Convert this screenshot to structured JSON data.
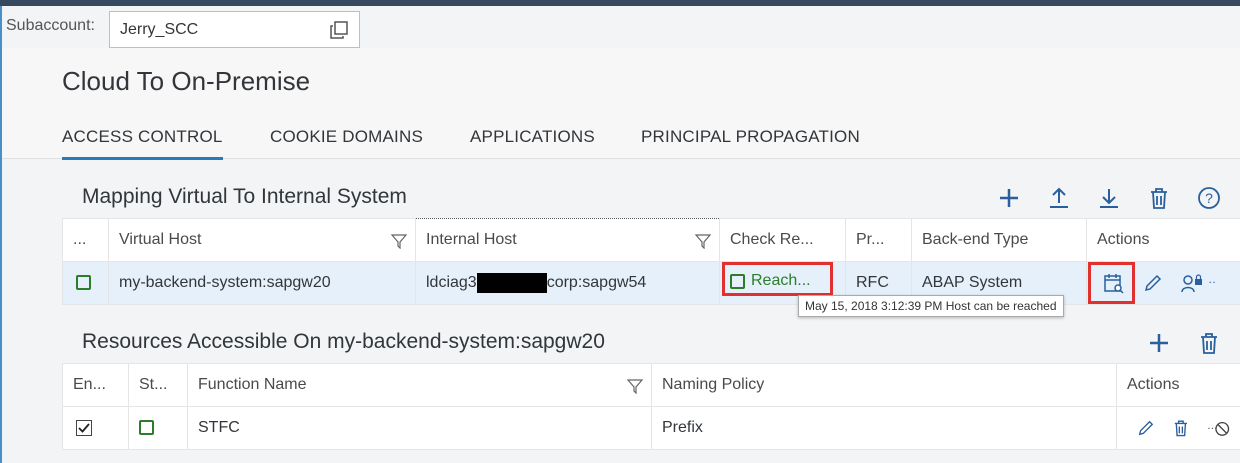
{
  "subaccount": {
    "label": "Subaccount:",
    "value": "Jerry_SCC",
    "switch_icon": "open-switch-icon"
  },
  "page": {
    "title": "Cloud To On-Premise",
    "tabs": [
      {
        "label": "ACCESS CONTROL",
        "active": true
      },
      {
        "label": "COOKIE DOMAINS",
        "active": false
      },
      {
        "label": "APPLICATIONS",
        "active": false
      },
      {
        "label": "PRINCIPAL PROPAGATION",
        "active": false
      }
    ]
  },
  "mapping": {
    "title": "Mapping Virtual To Internal System",
    "toolbar_icons": [
      "add-icon",
      "upload-icon",
      "download-icon",
      "delete-icon",
      "help-icon"
    ],
    "columns": [
      "...",
      "Virtual Host",
      "Internal Host",
      "Check Re...",
      "Pr...",
      "Back-end Type",
      "Actions"
    ],
    "rows": [
      {
        "status": "green",
        "virtual_host": "my-backend-system:sapgw20",
        "internal_host_prefix": "ldciag3",
        "internal_host_suffix": "corp:sapgw54",
        "check_result": "Reach...",
        "protocol": "RFC",
        "backend_type": "ABAP System"
      }
    ],
    "tooltip": "May 15, 2018 3:12:39 PM Host can be reached"
  },
  "resources": {
    "title": "Resources Accessible On my-backend-system:sapgw20",
    "toolbar_icons": [
      "add-icon",
      "delete-icon"
    ],
    "columns": [
      "En...",
      "St...",
      "Function Name",
      "Naming Policy",
      "Actions"
    ],
    "rows": [
      {
        "enabled": true,
        "status": "green",
        "function_name": "STFC",
        "naming_policy": "Prefix"
      }
    ]
  },
  "colors": {
    "accent": "#2a7ab8",
    "status_green": "#2b7d2b",
    "highlight_red": "#e03030",
    "selected_row": "#e5f0fa"
  }
}
